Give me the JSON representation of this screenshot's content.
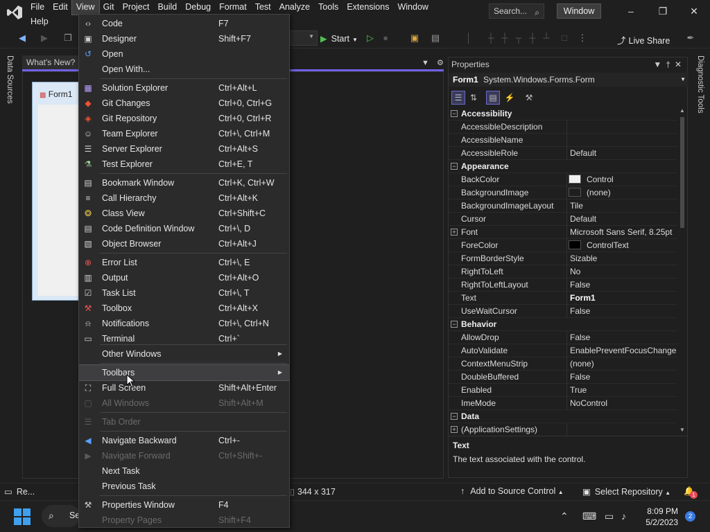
{
  "menubar": {
    "row1": [
      "File",
      "Edit",
      "View",
      "Git",
      "Project",
      "Build",
      "Debug",
      "Format",
      "Test",
      "Analyze",
      "Tools",
      "Extensions",
      "Window"
    ],
    "row2": [
      "Help"
    ],
    "search_label": "Search...",
    "window_badge": "Window"
  },
  "toolbar": {
    "start_label": "Start",
    "live_share_label": "Live Share"
  },
  "left_strip": {
    "data_sources": "Data Sources"
  },
  "right_strip": {
    "diagnostic_tools": "Diagnostic Tools"
  },
  "document": {
    "tab_label": "What's New?",
    "form_title": "Form1"
  },
  "view_menu": {
    "items": [
      {
        "icon": "code-icon",
        "label": "Code",
        "shortcut": "F7",
        "enabled": true
      },
      {
        "icon": "designer-icon",
        "label": "Designer",
        "shortcut": "Shift+F7",
        "enabled": true
      },
      {
        "icon": "open-icon",
        "label": "Open",
        "shortcut": "",
        "enabled": true
      },
      {
        "icon": "",
        "label": "Open With...",
        "shortcut": "",
        "enabled": true
      },
      {
        "icon": "solution-explorer-icon",
        "label": "Solution Explorer",
        "shortcut": "Ctrl+Alt+L",
        "enabled": true
      },
      {
        "icon": "git-changes-icon",
        "label": "Git Changes",
        "shortcut": "Ctrl+0, Ctrl+G",
        "enabled": true
      },
      {
        "icon": "git-repository-icon",
        "label": "Git Repository",
        "shortcut": "Ctrl+0, Ctrl+R",
        "enabled": true
      },
      {
        "icon": "team-explorer-icon",
        "label": "Team Explorer",
        "shortcut": "Ctrl+\\, Ctrl+M",
        "enabled": true
      },
      {
        "icon": "server-explorer-icon",
        "label": "Server Explorer",
        "shortcut": "Ctrl+Alt+S",
        "enabled": true
      },
      {
        "icon": "test-explorer-icon",
        "label": "Test Explorer",
        "shortcut": "Ctrl+E, T",
        "enabled": true
      },
      {
        "icon": "bookmark-icon",
        "label": "Bookmark Window",
        "shortcut": "Ctrl+K, Ctrl+W",
        "enabled": true
      },
      {
        "icon": "call-hierarchy-icon",
        "label": "Call Hierarchy",
        "shortcut": "Ctrl+Alt+K",
        "enabled": true
      },
      {
        "icon": "class-view-icon",
        "label": "Class View",
        "shortcut": "Ctrl+Shift+C",
        "enabled": true
      },
      {
        "icon": "code-definition-icon",
        "label": "Code Definition Window",
        "shortcut": "Ctrl+\\, D",
        "enabled": true
      },
      {
        "icon": "object-browser-icon",
        "label": "Object Browser",
        "shortcut": "Ctrl+Alt+J",
        "enabled": true
      },
      {
        "icon": "error-list-icon",
        "label": "Error List",
        "shortcut": "Ctrl+\\, E",
        "enabled": true
      },
      {
        "icon": "output-icon",
        "label": "Output",
        "shortcut": "Ctrl+Alt+O",
        "enabled": true
      },
      {
        "icon": "task-list-icon",
        "label": "Task List",
        "shortcut": "Ctrl+\\, T",
        "enabled": true
      },
      {
        "icon": "toolbox-icon",
        "label": "Toolbox",
        "shortcut": "Ctrl+Alt+X",
        "enabled": true
      },
      {
        "icon": "notifications-icon",
        "label": "Notifications",
        "shortcut": "Ctrl+\\, Ctrl+N",
        "enabled": true
      },
      {
        "icon": "terminal-icon",
        "label": "Terminal",
        "shortcut": "Ctrl+`",
        "enabled": true
      },
      {
        "icon": "",
        "label": "Other Windows",
        "shortcut": "",
        "enabled": true,
        "submenu": true
      },
      {
        "icon": "",
        "label": "Toolbars",
        "shortcut": "",
        "enabled": true,
        "submenu": true,
        "hover": true
      },
      {
        "icon": "full-screen-icon",
        "label": "Full Screen",
        "shortcut": "Shift+Alt+Enter",
        "enabled": true
      },
      {
        "icon": "all-windows-icon",
        "label": "All Windows",
        "shortcut": "Shift+Alt+M",
        "enabled": false
      },
      {
        "icon": "tab-order-icon",
        "label": "Tab Order",
        "shortcut": "",
        "enabled": false
      },
      {
        "icon": "navigate-backward-icon",
        "label": "Navigate Backward",
        "shortcut": "Ctrl+-",
        "enabled": true
      },
      {
        "icon": "navigate-forward-icon",
        "label": "Navigate Forward",
        "shortcut": "Ctrl+Shift+-",
        "enabled": false
      },
      {
        "icon": "",
        "label": "Next Task",
        "shortcut": "",
        "enabled": true
      },
      {
        "icon": "",
        "label": "Previous Task",
        "shortcut": "",
        "enabled": true
      },
      {
        "icon": "wrench-icon",
        "label": "Properties Window",
        "shortcut": "F4",
        "enabled": true
      },
      {
        "icon": "",
        "label": "Property Pages",
        "shortcut": "Shift+F4",
        "enabled": false
      }
    ]
  },
  "properties": {
    "title": "Properties",
    "object_name": "Form1",
    "object_type": "System.Windows.Forms.Form",
    "rows": [
      {
        "kind": "cat",
        "name": "Accessibility"
      },
      {
        "kind": "prop",
        "name": "AccessibleDescription",
        "value": ""
      },
      {
        "kind": "prop",
        "name": "AccessibleName",
        "value": ""
      },
      {
        "kind": "prop",
        "name": "AccessibleRole",
        "value": "Default"
      },
      {
        "kind": "cat",
        "name": "Appearance"
      },
      {
        "kind": "prop",
        "name": "BackColor",
        "value": "Control",
        "swatch": "#f0f0f0"
      },
      {
        "kind": "prop",
        "name": "BackgroundImage",
        "value": "(none)",
        "swatch": "#1f1f1f"
      },
      {
        "kind": "prop",
        "name": "BackgroundImageLayout",
        "value": "Tile"
      },
      {
        "kind": "prop",
        "name": "Cursor",
        "value": "Default"
      },
      {
        "kind": "prop",
        "name": "Font",
        "value": "Microsoft Sans Serif, 8.25pt",
        "expandable": true
      },
      {
        "kind": "prop",
        "name": "ForeColor",
        "value": "ControlText",
        "swatch": "#000000"
      },
      {
        "kind": "prop",
        "name": "FormBorderStyle",
        "value": "Sizable"
      },
      {
        "kind": "prop",
        "name": "RightToLeft",
        "value": "No"
      },
      {
        "kind": "prop",
        "name": "RightToLeftLayout",
        "value": "False"
      },
      {
        "kind": "prop",
        "name": "Text",
        "value": "Form1",
        "bold": true
      },
      {
        "kind": "prop",
        "name": "UseWaitCursor",
        "value": "False"
      },
      {
        "kind": "cat",
        "name": "Behavior"
      },
      {
        "kind": "prop",
        "name": "AllowDrop",
        "value": "False"
      },
      {
        "kind": "prop",
        "name": "AutoValidate",
        "value": "EnablePreventFocusChange"
      },
      {
        "kind": "prop",
        "name": "ContextMenuStrip",
        "value": "(none)"
      },
      {
        "kind": "prop",
        "name": "DoubleBuffered",
        "value": "False"
      },
      {
        "kind": "prop",
        "name": "Enabled",
        "value": "True"
      },
      {
        "kind": "prop",
        "name": "ImeMode",
        "value": "NoControl"
      },
      {
        "kind": "cat",
        "name": "Data"
      },
      {
        "kind": "prop",
        "name": "(ApplicationSettings)",
        "value": "",
        "expandable": true
      }
    ],
    "desc_title": "Text",
    "desc_body": "The text associated with the control."
  },
  "statusbar": {
    "ready": "Re...",
    "size": "344 x 317",
    "add_to_source_control": "Add to Source Control",
    "select_repository": "Select Repository",
    "notification_count": "1"
  },
  "taskbar": {
    "search_label": "Se",
    "time": "8:09 PM",
    "date": "5/2/2023",
    "badge": "2"
  }
}
